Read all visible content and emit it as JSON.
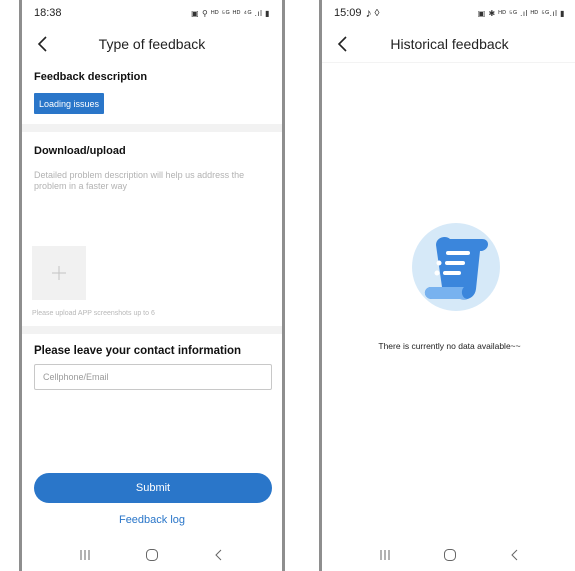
{
  "left_screen": {
    "status_bar": {
      "time": "18:38",
      "icons": "▣ ⚲ ᴴᴰ ⁵ᴳ ᴴᴰ ⁴ᴳ .ıl ▮"
    },
    "header": {
      "title": "Type of feedback"
    },
    "feedback_description": {
      "title": "Feedback description",
      "selected_chip": "Loading issues"
    },
    "download_upload": {
      "title": "Download/upload",
      "description": "Detailed problem description will help us address the problem in a faster way",
      "upload_hint": "Please upload APP screenshots up to 6"
    },
    "contact": {
      "title": "Please leave your contact information",
      "input_value": "",
      "input_placeholder": "Cellphone/Email"
    },
    "submit_label": "Submit",
    "feedback_log_label": "Feedback log"
  },
  "right_screen": {
    "status_bar": {
      "time": "15:09",
      "icons": "▣ ✱ ᴴᴰ ⁵ᴳ .ıl ᴴᴰ ⁵ᴳ.ıl ▮"
    },
    "header": {
      "title": "Historical feedback"
    },
    "empty_state": {
      "message": "There is currently no data available~~"
    }
  },
  "colors": {
    "accent": "#2a76c9",
    "illustration_circle": "#d6e9f8",
    "illustration_scroll": "#3b86dc"
  }
}
